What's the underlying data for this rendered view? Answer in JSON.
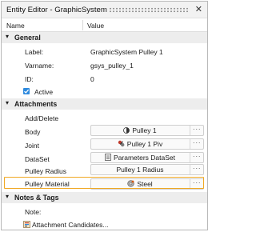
{
  "window": {
    "title": "Entity Editor - GraphicSystem"
  },
  "columns": {
    "name": "Name",
    "value": "Value"
  },
  "sections": {
    "general": "General",
    "attachments": "Attachments",
    "notes": "Notes & Tags"
  },
  "general": {
    "label_key": "Label:",
    "label_val": "GraphicSystem Pulley 1",
    "varname_key": "Varname:",
    "varname_val": "gsys_pulley_1",
    "id_key": "ID:",
    "id_val": "0",
    "active_label": "Active",
    "active_checked": true
  },
  "attachments": {
    "add_delete": "Add/Delete",
    "body_key": "Body",
    "body_val": "Pulley 1",
    "joint_key": "Joint",
    "joint_val": "Pulley 1 Piv",
    "dataset_key": "DataSet",
    "dataset_val": "Parameters DataSet",
    "radius_key": "Pulley Radius",
    "radius_val": "Pulley 1 Radius",
    "material_key": "Pulley Material",
    "material_val": "Steel"
  },
  "notes": {
    "note_key": "Note:",
    "candidates": "Attachment Candidates..."
  },
  "colors": {
    "highlight": "#f0a823",
    "checkbox": "#2e8ade",
    "section_bg": "#ededed"
  }
}
